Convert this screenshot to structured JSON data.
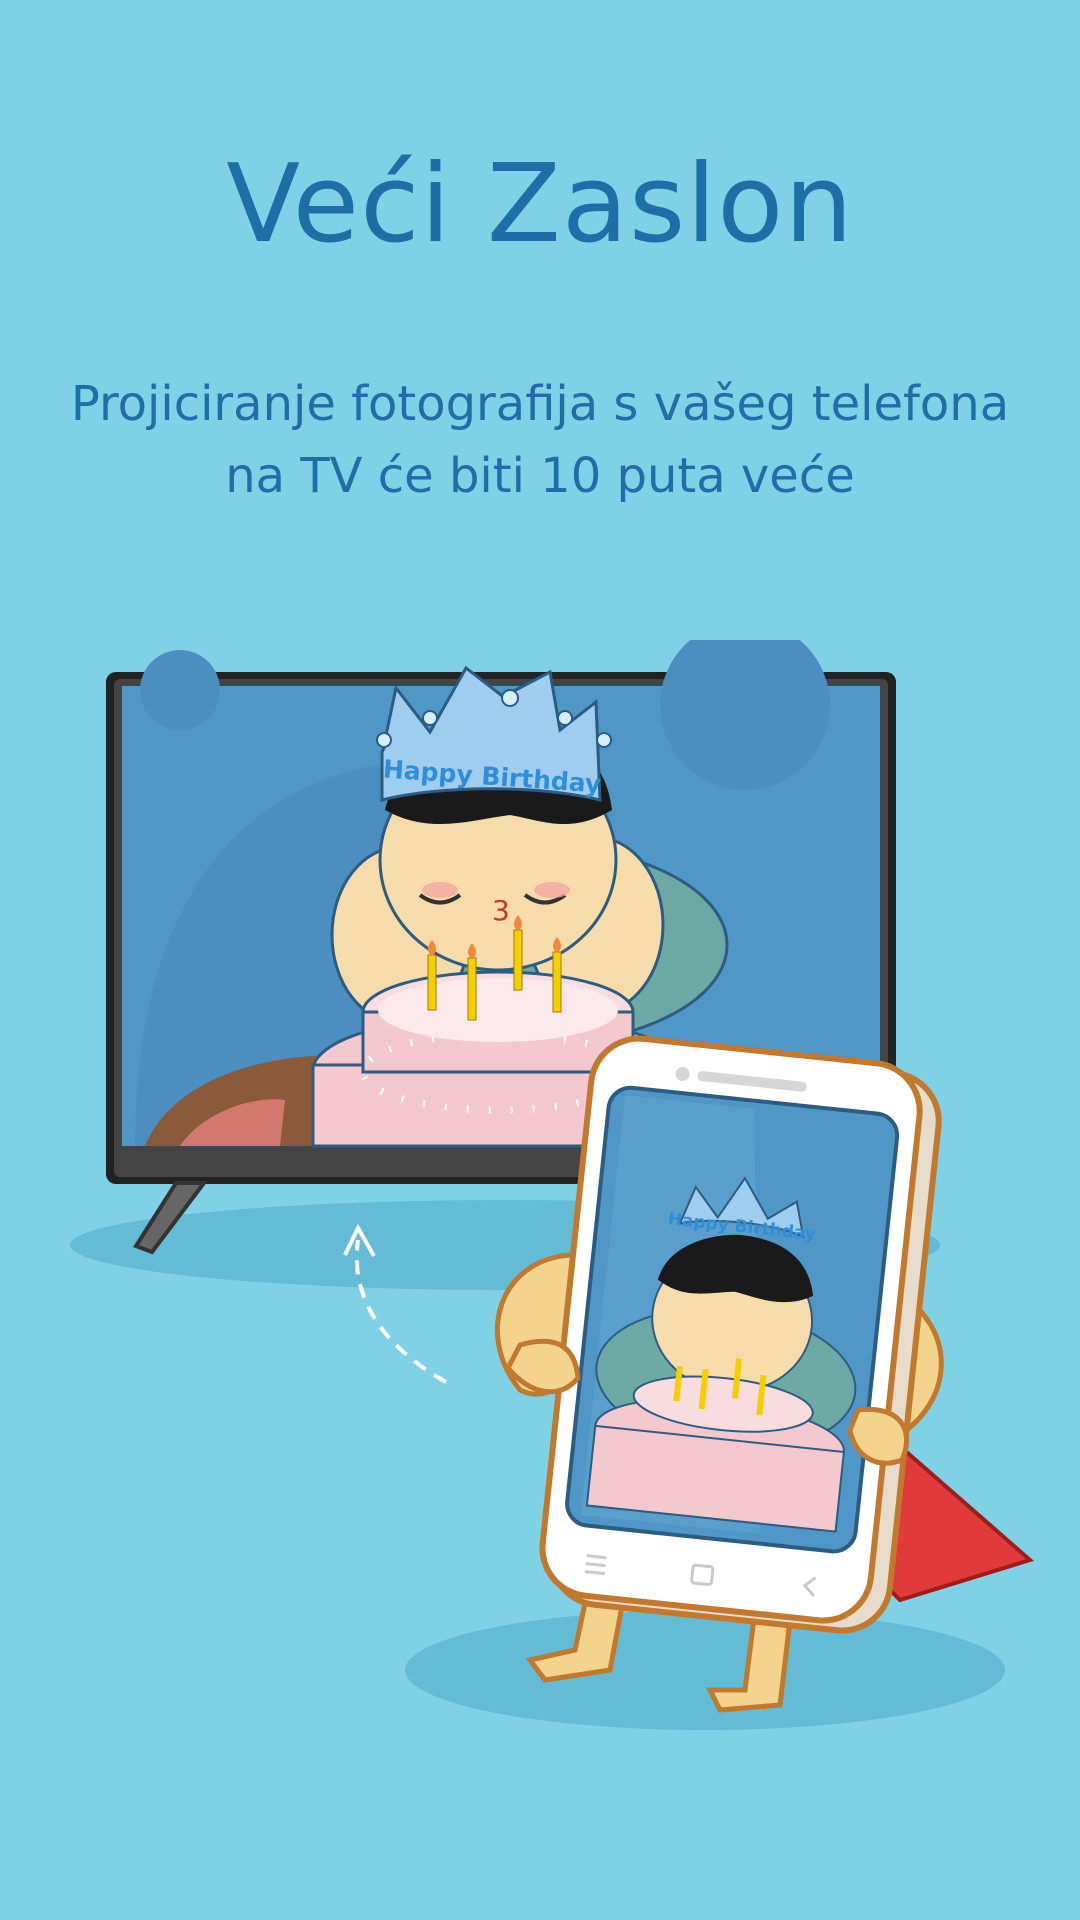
{
  "title": "Veći Zaslon",
  "subtitle": {
    "line1": "Projiciranje fotografija s vašeg telefona",
    "line2": "na TV će biti 10 puta veće"
  },
  "illustration": {
    "crown_text_tv": "Happy Birthday",
    "crown_text_phone": "Happy Birthday"
  },
  "colors": {
    "background": "#7fd1e6",
    "title": "#1f6ea8",
    "tv_screen": "#4f97c6",
    "cake": "#f3c9cf",
    "cape": "#e03a3a"
  }
}
